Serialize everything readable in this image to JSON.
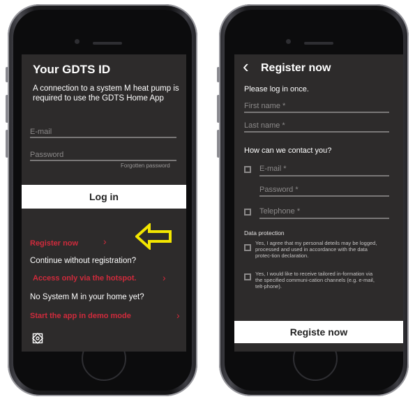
{
  "login": {
    "title": "Your GDTS ID",
    "description": "A connection to a system M heat pump is required to use the GDTS Home App",
    "email_label": "E-mail",
    "password_label": "Password",
    "forgot_password": "Forgotten password",
    "login_button": "Log in",
    "register_link": "Register now",
    "continue_text": "Continue without registration?",
    "hotspot_link": "Access only via the hotspot.",
    "no_system_text": "No System M in your home yet?",
    "demo_link": "Start the app in demo mode",
    "chevron": "›"
  },
  "register": {
    "back": "‹",
    "title": "Register now",
    "subtitle": "Please log in once.",
    "first_name": "First name *",
    "last_name": "Last name *",
    "contact_question": "How can we contact you?",
    "email": "E-mail *",
    "password": "Password *",
    "telephone": "Telephone *",
    "data_protection": "Data protection",
    "consent_1": "Yes, I agree that my personal deteils may be logged, processed and used in accordance with the data protec-tion declaration.",
    "consent_2": "Yes, I would like to receive tailored in-formation via the specified communi-cation channels (e.g. e-mail, telt-phone).",
    "register_button": "Registe now"
  },
  "colors": {
    "accent_red": "#d02b3c",
    "arrow_yellow": "#f3e600",
    "screen_bg": "#2d2b2b"
  }
}
